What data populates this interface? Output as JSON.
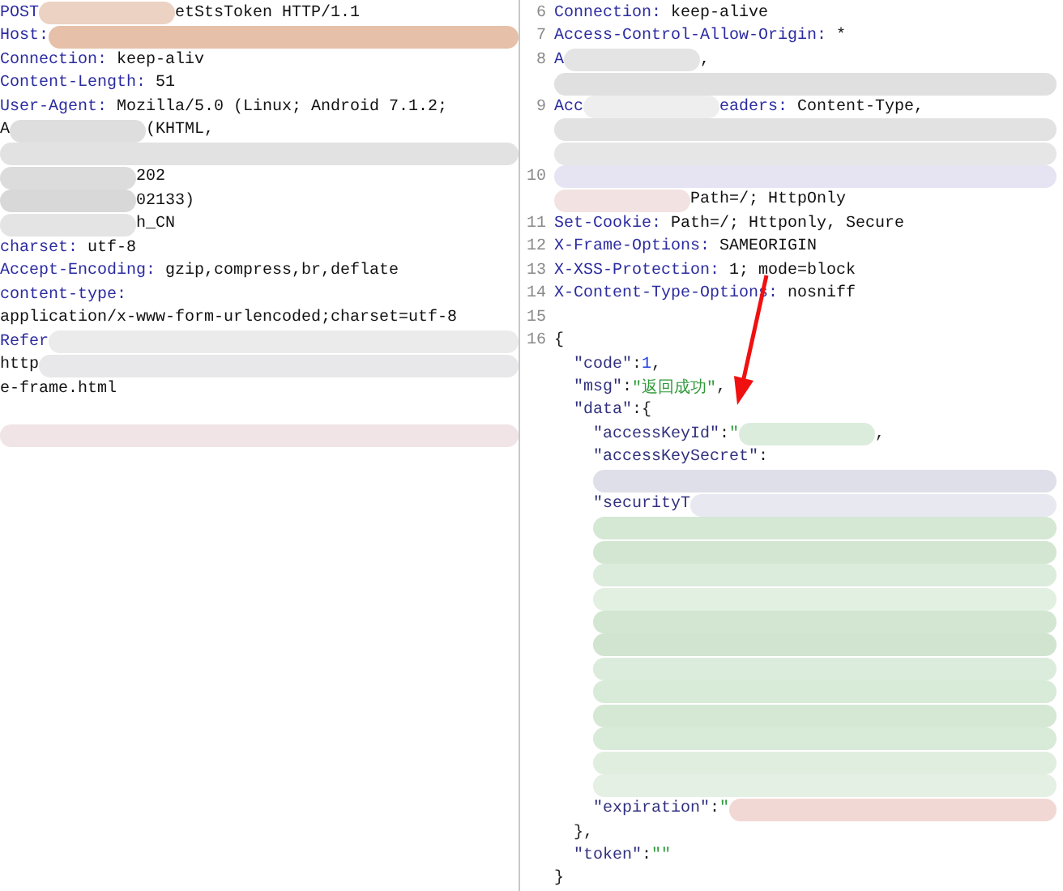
{
  "request": {
    "lines": [
      {
        "segments": [
          {
            "kind": "key",
            "text": "POST"
          },
          {
            "kind": "redacted",
            "color": "#ecd2c2"
          },
          {
            "kind": "value",
            "text": "etStsToken HTTP/1.1"
          }
        ]
      },
      {
        "segments": [
          {
            "kind": "key",
            "text": "Host:"
          },
          {
            "kind": "redacted",
            "color": "#e6c0a8"
          }
        ]
      },
      {
        "segments": [
          {
            "kind": "key",
            "text": "Connection:"
          },
          {
            "kind": "value",
            "text": " keep-aliv"
          }
        ]
      },
      {
        "segments": [
          {
            "kind": "key",
            "text": "Content-Length:"
          },
          {
            "kind": "value",
            "text": " 51"
          }
        ]
      },
      {
        "segments": [
          {
            "kind": "key",
            "text": "User-Agent:"
          },
          {
            "kind": "value",
            "text": " Mozilla/5.0 (Linux; Android 7.1.2;"
          }
        ]
      },
      {
        "segments": [
          {
            "kind": "value",
            "text": "A"
          },
          {
            "kind": "redacted",
            "color": "#dedede"
          },
          {
            "kind": "value",
            "text": "(KHTML,"
          }
        ]
      },
      {
        "segments": [
          {
            "kind": "redacted",
            "color": "#e2e2e2"
          }
        ]
      },
      {
        "segments": [
          {
            "kind": "redacted",
            "color": "#dcdcdc"
          },
          {
            "kind": "value",
            "text": "202"
          }
        ]
      },
      {
        "segments": [
          {
            "kind": "redacted",
            "color": "#d8d8d8"
          },
          {
            "kind": "value",
            "text": "02133)"
          }
        ]
      },
      {
        "segments": [
          {
            "kind": "redacted",
            "color": "#e4e4e4"
          },
          {
            "kind": "value",
            "text": "h_CN"
          }
        ]
      },
      {
        "segments": [
          {
            "kind": "key",
            "text": "charset:"
          },
          {
            "kind": "value",
            "text": " utf-8"
          }
        ]
      },
      {
        "segments": [
          {
            "kind": "key",
            "text": "Accept-Encoding:"
          },
          {
            "kind": "value",
            "text": " gzip,compress,br,deflate"
          }
        ]
      },
      {
        "segments": [
          {
            "kind": "key",
            "text": "content-type:"
          }
        ]
      },
      {
        "segments": [
          {
            "kind": "value",
            "text": "application/x-www-form-urlencoded;charset=utf-8"
          }
        ]
      },
      {
        "segments": [
          {
            "kind": "key",
            "text": "Refer"
          },
          {
            "kind": "redacted",
            "color": "#ebebeb"
          }
        ]
      },
      {
        "segments": [
          {
            "kind": "value",
            "text": "http"
          },
          {
            "kind": "redacted",
            "color": "#e8e8ea"
          }
        ]
      },
      {
        "segments": [
          {
            "kind": "value",
            "text": "e-frame.html"
          }
        ]
      },
      {
        "segments": [
          {
            "kind": "redacted",
            "color": "#f0e4e6"
          }
        ]
      }
    ]
  },
  "response": {
    "lines": [
      {
        "number": "6",
        "segments": [
          {
            "kind": "key",
            "text": "Connection:"
          },
          {
            "kind": "value",
            "text": " keep-alive"
          }
        ]
      },
      {
        "number": "7",
        "segments": [
          {
            "kind": "key",
            "text": "Access-Control-Allow-Origin:"
          },
          {
            "kind": "value",
            "text": " *"
          }
        ]
      },
      {
        "number": "8",
        "segments": [
          {
            "kind": "key",
            "text": "A"
          },
          {
            "kind": "redacted",
            "color": "#e4e4e4"
          },
          {
            "kind": "value",
            "text": ","
          }
        ]
      },
      {
        "segments": [
          {
            "kind": "redacted",
            "color": "#e0e0e0"
          }
        ]
      },
      {
        "number": "9",
        "segments": [
          {
            "kind": "key",
            "text": "Acc"
          },
          {
            "kind": "redacted",
            "color": "#eeeeee"
          },
          {
            "kind": "key",
            "text": "eaders:"
          },
          {
            "kind": "value",
            "text": " Content-Type,"
          }
        ]
      },
      {
        "segments": [
          {
            "kind": "redacted",
            "color": "#e2e2e2"
          }
        ]
      },
      {
        "segments": [
          {
            "kind": "redacted",
            "color": "#e6e6e6"
          }
        ]
      },
      {
        "number": "10",
        "segments": [
          {
            "kind": "redacted",
            "color": "#e6e4f2"
          }
        ]
      },
      {
        "segments": [
          {
            "kind": "redacted",
            "color": "#f2e2e2"
          },
          {
            "kind": "value",
            "text": "Path=/; HttpOnly"
          }
        ]
      },
      {
        "number": "11",
        "segments": [
          {
            "kind": "key",
            "text": "Set-Cookie:"
          },
          {
            "kind": "value",
            "text": " Path=/; Httponly, Secure"
          }
        ]
      },
      {
        "number": "12",
        "segments": [
          {
            "kind": "key",
            "text": "X-Frame-Options:"
          },
          {
            "kind": "value",
            "text": " SAMEORIGIN"
          }
        ]
      },
      {
        "number": "13",
        "segments": [
          {
            "kind": "key",
            "text": "X-XSS-Protection:"
          },
          {
            "kind": "value",
            "text": " 1; mode=block"
          }
        ]
      },
      {
        "number": "14",
        "segments": [
          {
            "kind": "key",
            "text": "X-Content-Type-Options:"
          },
          {
            "kind": "value",
            "text": " nosniff"
          }
        ]
      },
      {
        "number": "15"
      }
    ],
    "body": {
      "number": "16",
      "segments": [
        {
          "kind": "punct",
          "text": "{"
        }
      ],
      "closing": [
        {
          "kind": "punct",
          "text": "}"
        }
      ],
      "children": [
        {
          "segments": [
            {
              "kind": "json-key",
              "text": "\"code\""
            },
            {
              "kind": "punct",
              "text": ":"
            },
            {
              "kind": "number",
              "text": "1"
            },
            {
              "kind": "punct",
              "text": ","
            }
          ]
        },
        {
          "segments": [
            {
              "kind": "json-key",
              "text": "\"msg\""
            },
            {
              "kind": "punct",
              "text": ":"
            },
            {
              "kind": "string",
              "text": "\"返回成功\""
            },
            {
              "kind": "punct",
              "text": ","
            }
          ]
        },
        {
          "segments": [
            {
              "kind": "json-key",
              "text": "\"data\""
            },
            {
              "kind": "punct",
              "text": ":{"
            }
          ],
          "closing": [
            {
              "kind": "punct",
              "text": "},"
            }
          ],
          "children": [
            {
              "segments": [
                {
                  "kind": "json-key",
                  "text": "\"accessKeyId\""
                },
                {
                  "kind": "punct",
                  "text": ":"
                },
                {
                  "kind": "string",
                  "text": "\""
                },
                {
                  "kind": "redacted",
                  "color": "#dcecdc"
                },
                {
                  "kind": "punct",
                  "text": ","
                }
              ]
            },
            {
              "segments": [
                {
                  "kind": "json-key",
                  "text": "\"accessKeySecret\""
                },
                {
                  "kind": "punct",
                  "text": ":"
                }
              ]
            },
            {
              "segments": [
                {
                  "kind": "redacted",
                  "color": "#dedfe8"
                }
              ]
            },
            {
              "segments": [
                {
                  "kind": "json-key",
                  "text": "\"securityT"
                },
                {
                  "kind": "redacted",
                  "color": "#e8e8f0"
                }
              ]
            },
            {
              "segments": [
                {
                  "kind": "redacted",
                  "color": "#d4e8d4"
                }
              ]
            },
            {
              "segments": [
                {
                  "kind": "redacted",
                  "color": "#d2e6d2"
                }
              ]
            },
            {
              "segments": [
                {
                  "kind": "redacted",
                  "color": "#dcecdc"
                }
              ]
            },
            {
              "segments": [
                {
                  "kind": "redacted",
                  "color": "#e2f0e2"
                }
              ]
            },
            {
              "segments": [
                {
                  "kind": "redacted",
                  "color": "#d2e6d2"
                }
              ]
            },
            {
              "segments": [
                {
                  "kind": "redacted",
                  "color": "#d0e4d0"
                }
              ]
            },
            {
              "segments": [
                {
                  "kind": "redacted",
                  "color": "#dcecdc"
                }
              ]
            },
            {
              "segments": [
                {
                  "kind": "redacted",
                  "color": "#d8ead8"
                }
              ]
            },
            {
              "segments": [
                {
                  "kind": "redacted",
                  "color": "#d4e8d4"
                }
              ]
            },
            {
              "segments": [
                {
                  "kind": "redacted",
                  "color": "#d8ead8"
                }
              ]
            },
            {
              "segments": [
                {
                  "kind": "redacted",
                  "color": "#e0eee0"
                }
              ]
            },
            {
              "segments": [
                {
                  "kind": "redacted",
                  "color": "#e4f0e4"
                }
              ]
            },
            {
              "segments": [
                {
                  "kind": "json-key",
                  "text": "\"expiration\""
                },
                {
                  "kind": "punct",
                  "text": ":"
                },
                {
                  "kind": "string",
                  "text": "\""
                },
                {
                  "kind": "redacted",
                  "color": "#f2d8d4"
                }
              ]
            }
          ]
        },
        {
          "segments": [
            {
              "kind": "json-key",
              "text": "\"token\""
            },
            {
              "kind": "punct",
              "text": ":"
            },
            {
              "kind": "string",
              "text": "\"\""
            }
          ]
        }
      ]
    }
  }
}
